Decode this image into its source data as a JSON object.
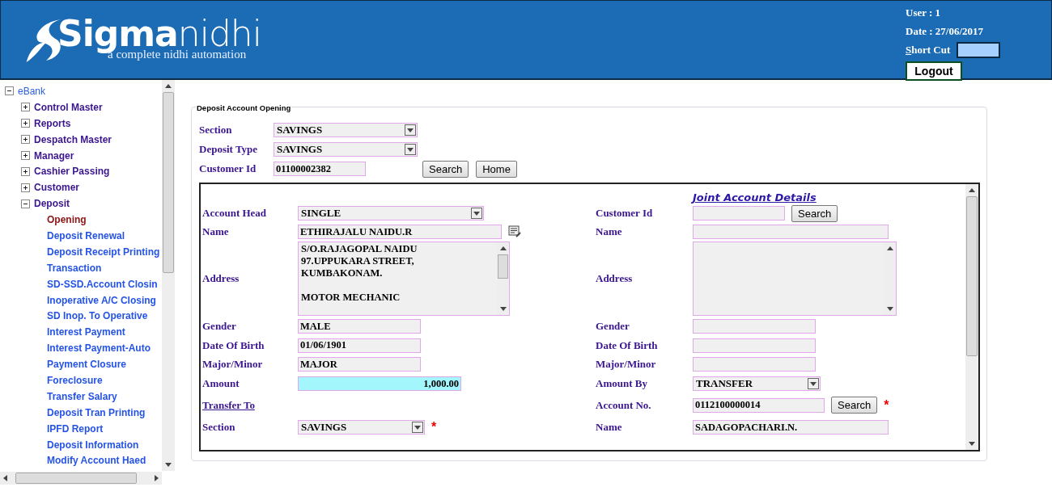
{
  "header": {
    "logo": {
      "bold": "Sigma",
      "light": "nidhi",
      "tagline": "a complete nidhi automation"
    },
    "user": "User : 1",
    "date": "Date : 27/06/2017",
    "shortcut": {
      "label": "Short Cut"
    },
    "logout": "Logout"
  },
  "sidebar": {
    "tree": [
      {
        "label": "eBank",
        "expanded": true,
        "children": [
          {
            "label": "Control Master",
            "expanded": false
          },
          {
            "label": "Reports",
            "expanded": false
          },
          {
            "label": "Despatch Master",
            "expanded": false
          },
          {
            "label": "Manager",
            "expanded": false
          },
          {
            "label": "Cashier Passing",
            "expanded": false
          },
          {
            "label": "Customer",
            "expanded": false
          },
          {
            "label": "Deposit",
            "expanded": true,
            "children": [
              {
                "label": "Opening",
                "selected": true
              },
              {
                "label": "Deposit Renewal",
                "selected": false
              },
              {
                "label": "Deposit Receipt Printing",
                "selected": false
              },
              {
                "label": "Transaction",
                "selected": false
              },
              {
                "label": "SD-SSD.Account Closin",
                "selected": false
              },
              {
                "label": "Inoperative A/C Closing",
                "selected": false
              },
              {
                "label": "SD Inop. To Operative",
                "selected": false
              },
              {
                "label": "Interest Payment",
                "selected": false
              },
              {
                "label": "Interest Payment-Auto",
                "selected": false
              },
              {
                "label": "Payment Closure",
                "selected": false
              },
              {
                "label": "Foreclosure",
                "selected": false
              },
              {
                "label": "Transfer Salary",
                "selected": false
              },
              {
                "label": "Deposit Tran Printing",
                "selected": false
              },
              {
                "label": "IPFD Report",
                "selected": false
              },
              {
                "label": "Deposit Information",
                "selected": false
              },
              {
                "label": "Modify Account Haed",
                "selected": false
              }
            ]
          }
        ]
      }
    ]
  },
  "form": {
    "legend": "Deposit Account Opening",
    "top_fields": [
      {
        "label": "Section",
        "kind": "select",
        "value": "SAVINGS"
      },
      {
        "label": "Deposit Type",
        "kind": "select",
        "value": "SAVINGS"
      },
      {
        "label": "Customer Id",
        "kind": "text",
        "value": "01100002382",
        "buttons": [
          "Search",
          "Home"
        ]
      }
    ],
    "detail_rows": [
      {
        "right": {
          "kind": "heading",
          "label": "Joint Account Details"
        }
      },
      {
        "left": {
          "kind": "select",
          "label": "Account Head",
          "value": "SINGLE"
        },
        "right": {
          "kind": "text",
          "label": "Customer Id",
          "buttons": [
            "Search"
          ]
        }
      },
      {
        "left": {
          "kind": "text",
          "label": "Name",
          "value": "ETHIRAJALU NAIDU.R",
          "icon": true
        },
        "right": {
          "kind": "text",
          "label": "Name"
        }
      },
      {
        "left": {
          "kind": "textarea",
          "label": "Address",
          "paragraphs": [
            [
              "S/O.RAJAGOPAL NAIDU",
              "97.UPPUKARA STREET,",
              "KUMBAKONAM."
            ],
            [
              "MOTOR MECHANIC"
            ]
          ]
        },
        "right": {
          "kind": "textarea",
          "label": "Address"
        }
      },
      {
        "left": {
          "kind": "text",
          "label": "Gender",
          "value": "MALE"
        },
        "right": {
          "kind": "text",
          "label": "Gender"
        }
      },
      {
        "left": {
          "kind": "text",
          "label": "Date Of Birth",
          "value": "01/06/1901"
        },
        "right": {
          "kind": "text",
          "label": "Date Of Birth"
        }
      },
      {
        "left": {
          "kind": "text",
          "label": "Major/Minor",
          "value": "MAJOR"
        },
        "right": {
          "kind": "text",
          "label": "Major/Minor"
        }
      },
      {
        "left": {
          "kind": "amount",
          "label": "Amount",
          "value": "1,000.00"
        },
        "right": {
          "kind": "select",
          "label": "Amount By",
          "value": "TRANSFER"
        }
      },
      {
        "left": {
          "kind": "link",
          "label": "Transfer To"
        },
        "right": {
          "kind": "text",
          "label": "Account No.",
          "value": "0112100000014",
          "buttons": [
            "Search"
          ],
          "required_mark": "*"
        }
      },
      {
        "left": {
          "kind": "select",
          "label": "Section",
          "value": "SAVINGS",
          "required_mark": "*"
        },
        "right": {
          "kind": "text",
          "label": "Name",
          "value": "SADAGOPACHARI.N."
        }
      }
    ]
  }
}
